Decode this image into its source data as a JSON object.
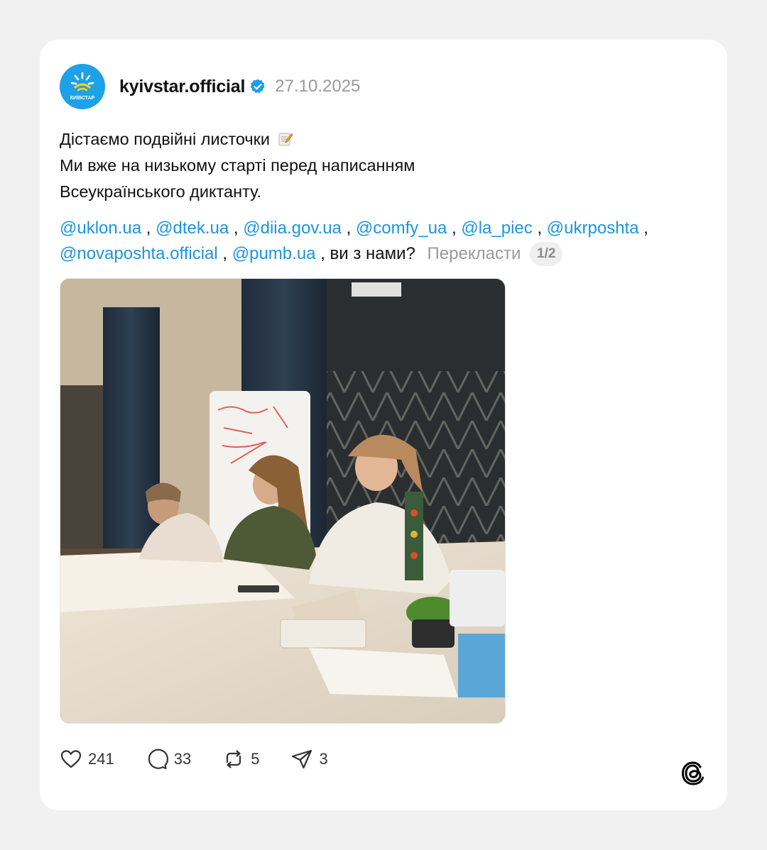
{
  "post": {
    "username": "kyivstar.official",
    "date": "27.10.2025",
    "avatar_label": "КИЇВСТАР",
    "text_lines": [
      "Дістаємо подвійні листочки",
      "Ми вже на низькому старті перед написанням",
      "Всеукраїнського диктанту."
    ],
    "mentions": [
      "@uklon.ua",
      "@dtek.ua",
      "@diia.gov.ua",
      "@comfy_ua",
      "@la_piec",
      "@ukrposhta",
      "@novaposhta.official",
      "@pumb.ua"
    ],
    "separator": ",",
    "question": ", ви з нами?",
    "translate_label": "Перекласти",
    "pager": "1/2",
    "photo_description_name": "post-photo"
  },
  "actions": {
    "likes": "241",
    "comments": "33",
    "reposts": "5",
    "shares": "3"
  },
  "icons": {
    "like": "heart-icon",
    "comment": "comment-bubble-icon",
    "repost": "repost-icon",
    "share": "paper-plane-icon",
    "verified": "verified-badge-icon",
    "emoji": "memo-emoji-icon",
    "brand": "threads-logo-icon"
  },
  "colors": {
    "accent": "#1b95e0",
    "avatar_bg": "#1da1e8",
    "verified": "#1d9bf0",
    "muted": "#9a9a9a",
    "page_bg": "#f1f1f1",
    "card_bg": "#ffffff"
  }
}
